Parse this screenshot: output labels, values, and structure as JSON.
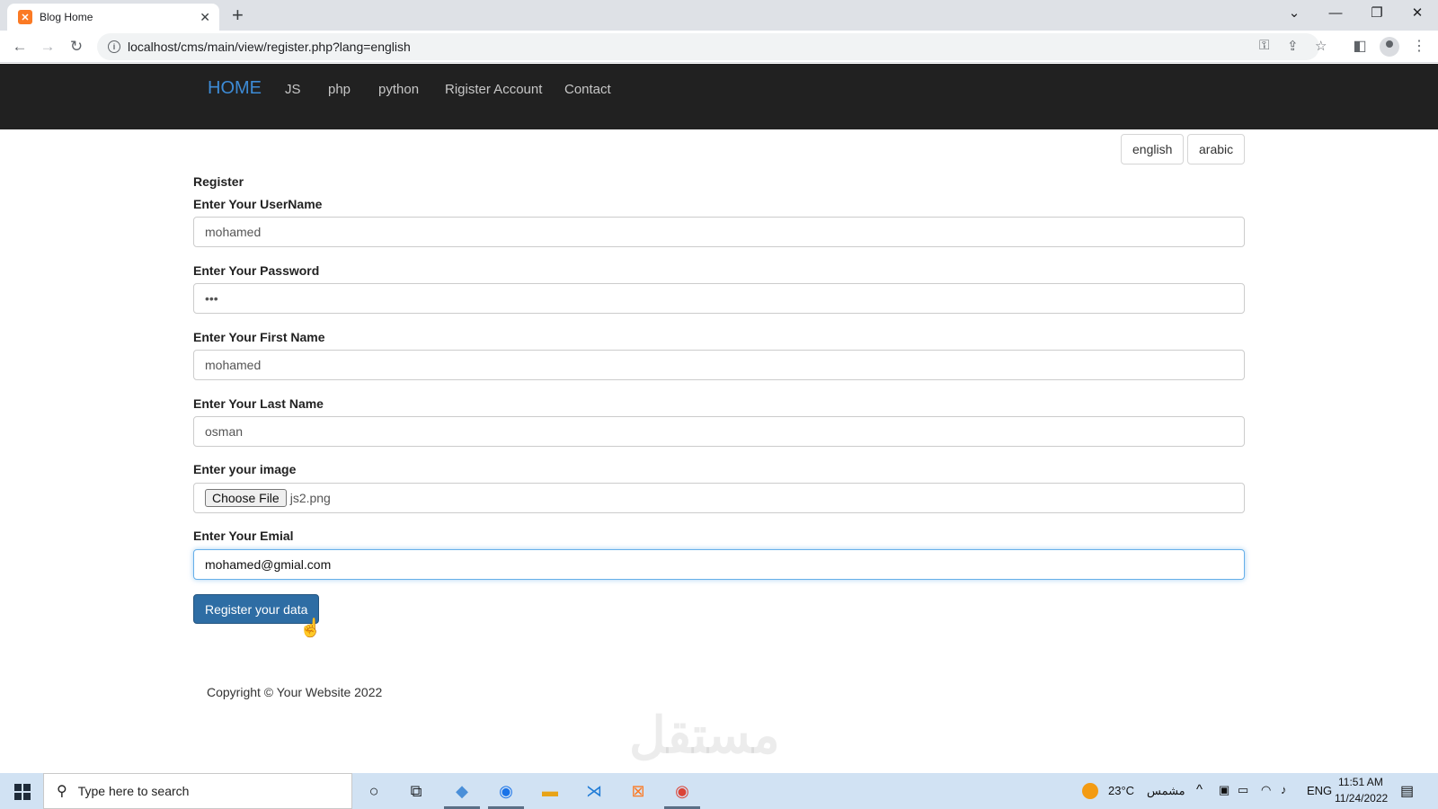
{
  "browser": {
    "tab_title": "Blog Home",
    "tab_close": "✕",
    "new_tab": "+",
    "url": "localhost/cms/main/view/register.php?lang=english"
  },
  "navbar": {
    "brand": "HOME",
    "links": [
      "JS",
      "php",
      "python",
      "Rigister Account",
      "Contact"
    ]
  },
  "language": {
    "english": "english",
    "arabic": "arabic"
  },
  "form": {
    "title": "Register",
    "username_label": "Enter Your UserName",
    "username_value": "mohamed",
    "password_label": "Enter Your Password",
    "password_value": "•••",
    "first_name_label": "Enter Your First Name",
    "first_name_value": "mohamed",
    "last_name_label": "Enter Your Last Name",
    "last_name_value": "osman",
    "image_label": "Enter your image",
    "choose_file_label": "Choose File",
    "file_name": "js2.png",
    "email_label": "Enter Your Emial",
    "email_value": "mohamed@gmial.com",
    "submit_label": "Register your data"
  },
  "footer": {
    "copyright": "Copyright © Your Website 2022"
  },
  "watermark": {
    "text": "مستقل"
  },
  "taskbar": {
    "search_placeholder": "Type here to search",
    "temperature": "23°C",
    "weather_text": "مشمس",
    "language": "ENG",
    "time": "11:51 AM",
    "date": "11/24/2022"
  },
  "colors": {
    "navbar_bg": "#212121",
    "brand": "#3d8bd6",
    "primary_button": "#2e6da4",
    "taskbar_bg": "#d1e2f3"
  }
}
